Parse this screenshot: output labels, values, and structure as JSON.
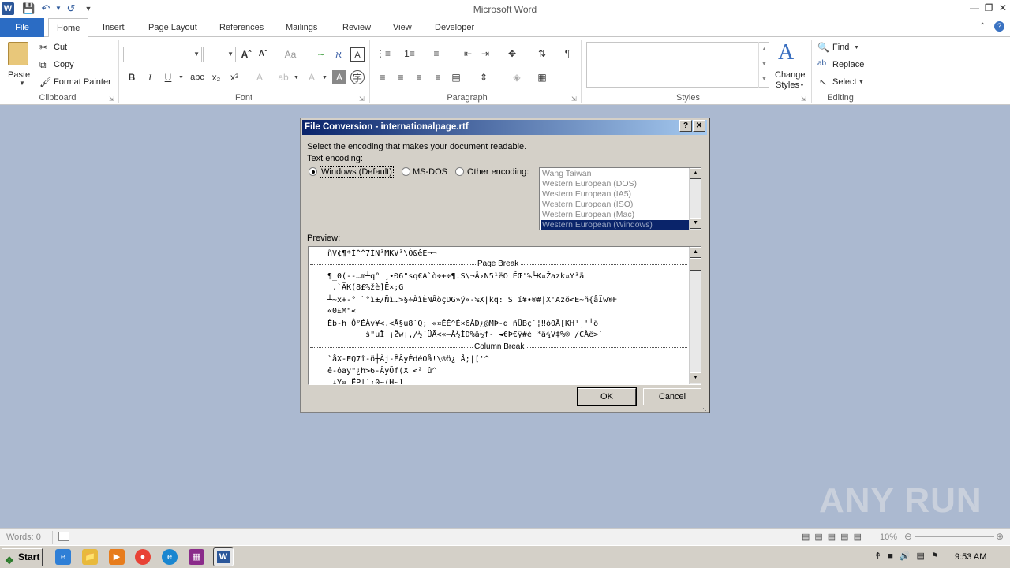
{
  "window": {
    "title": "Microsoft Word"
  },
  "qat": {
    "save_icon": "save-icon",
    "undo_icon": "undo-icon",
    "redo_icon": "redo-icon"
  },
  "tabs": [
    "File",
    "Home",
    "Insert",
    "Page Layout",
    "References",
    "Mailings",
    "Review",
    "View",
    "Developer"
  ],
  "clipboard": {
    "paste": "Paste",
    "cut": "Cut",
    "copy": "Copy",
    "format_painter": "Format Painter",
    "group": "Clipboard"
  },
  "font": {
    "group": "Font",
    "family": "",
    "size": ""
  },
  "paragraph": {
    "group": "Paragraph"
  },
  "styles": {
    "group": "Styles",
    "change_styles_1": "Change",
    "change_styles_2": "Styles"
  },
  "editing": {
    "group": "Editing",
    "find": "Find",
    "replace": "Replace",
    "select": "Select"
  },
  "dialog": {
    "title": "File Conversion - internationalpage.rtf",
    "help": "?",
    "close": "✕",
    "instruction": "Select the encoding that makes your document readable.",
    "text_encoding_label": "Text encoding:",
    "opt_windows": "Windows (Default)",
    "opt_msdos": "MS-DOS",
    "opt_other": "Other encoding:",
    "encodings": [
      "Wang Taiwan",
      "Western European (DOS)",
      "Western European (IA5)",
      "Western European (ISO)",
      "Western European (Mac)",
      "Western European (Windows)"
    ],
    "selected_encoding": "Western European (Windows)",
    "preview_label": "Preview:",
    "preview_lines": [
      "ñV¢¶*Ì^^7ÍN³MKV³\\Ô&êË¬¬",
      "¶_0(--…m┴q° ¸•Ð6\"sq€A`ò÷+÷¶.S\\¬Â›N5¹ëO ËŒ'%└K¤Žazk¤Y³ä",
      " .`ÄK(8£%žè]Ë×;G",
      "┴~x+-° `°ì±/Ñì…>§÷ÀìÈNÂöçDG»ÿ«-%X|kq: S í¥•®#|X'Azõ<E~ñ{åÏw®F",
      "«0£M\"«",
      "Èb-h Ô°ÉÀv¥<.<Å§u8`Q; «¤ÉÉ^É×6ÀD¿@MÞ-q ñÜBç`¦‼ò0Ä[KH¹¸'└ö",
      "        š\"uÏ ¡Žw¡,/½´ÜÃ<«—Å½ÌD%â½f- ◄€Þ€ÿ#é ³ã¾V‡%® /CÀê>`",
      "`åX-EQ7î-ö┼Àj-ÊÂyÉdéOå!\\®ö¿ Å;|['^",
      "ê-ôay\"¿h>6-ÂyÕf(X <² û^",
      " ↓Y¤ ËP|`:0~(H~]"
    ],
    "page_break": "Page Break",
    "column_break": "Column Break",
    "ok": "OK",
    "cancel": "Cancel"
  },
  "status": {
    "words": "Words: 0",
    "zoom": "10%"
  },
  "taskbar": {
    "start": "Start",
    "clock": "9:53 AM"
  },
  "watermark": "ANY RUN"
}
